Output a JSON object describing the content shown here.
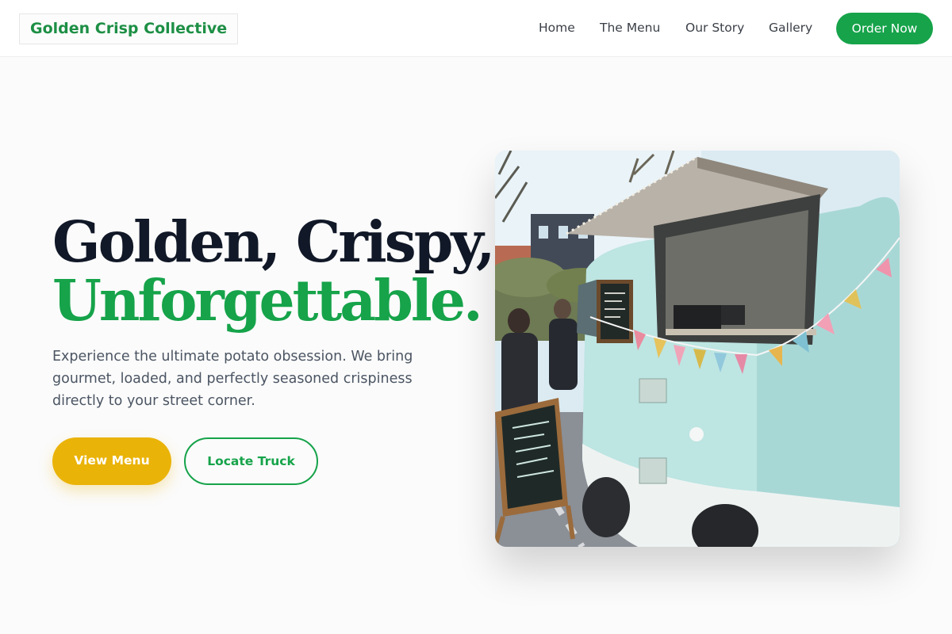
{
  "header": {
    "brand": "Golden Crisp Collective",
    "nav": [
      "Home",
      "The Menu",
      "Our Story",
      "Gallery"
    ],
    "cta": "Order Now"
  },
  "hero": {
    "headline_line1": "Golden, Crispy,",
    "headline_line2": "Unforgettable.",
    "description": "Experience the ultimate potato obsession. We bring gourmet, loaded, and perfectly seasoned crispiness directly to your street corner.",
    "primary_button": "View Menu",
    "secondary_button": "Locate Truck"
  },
  "image": {
    "subject": "Light blue vintage food truck with open serving hatch, colorful bunting flags and a chalkboard sign",
    "chalkboard_lines": [
      "Seasonal",
      "Coffee Bar",
      "Iced",
      "Ice Cream",
      "Milkshakes",
      "Homemade Cakes"
    ]
  },
  "colors": {
    "primary_green": "#16a34a",
    "accent_yellow": "#eab308",
    "heading_dark": "#111827",
    "body_text": "#4b5563",
    "page_background": "#fbfbfb"
  }
}
